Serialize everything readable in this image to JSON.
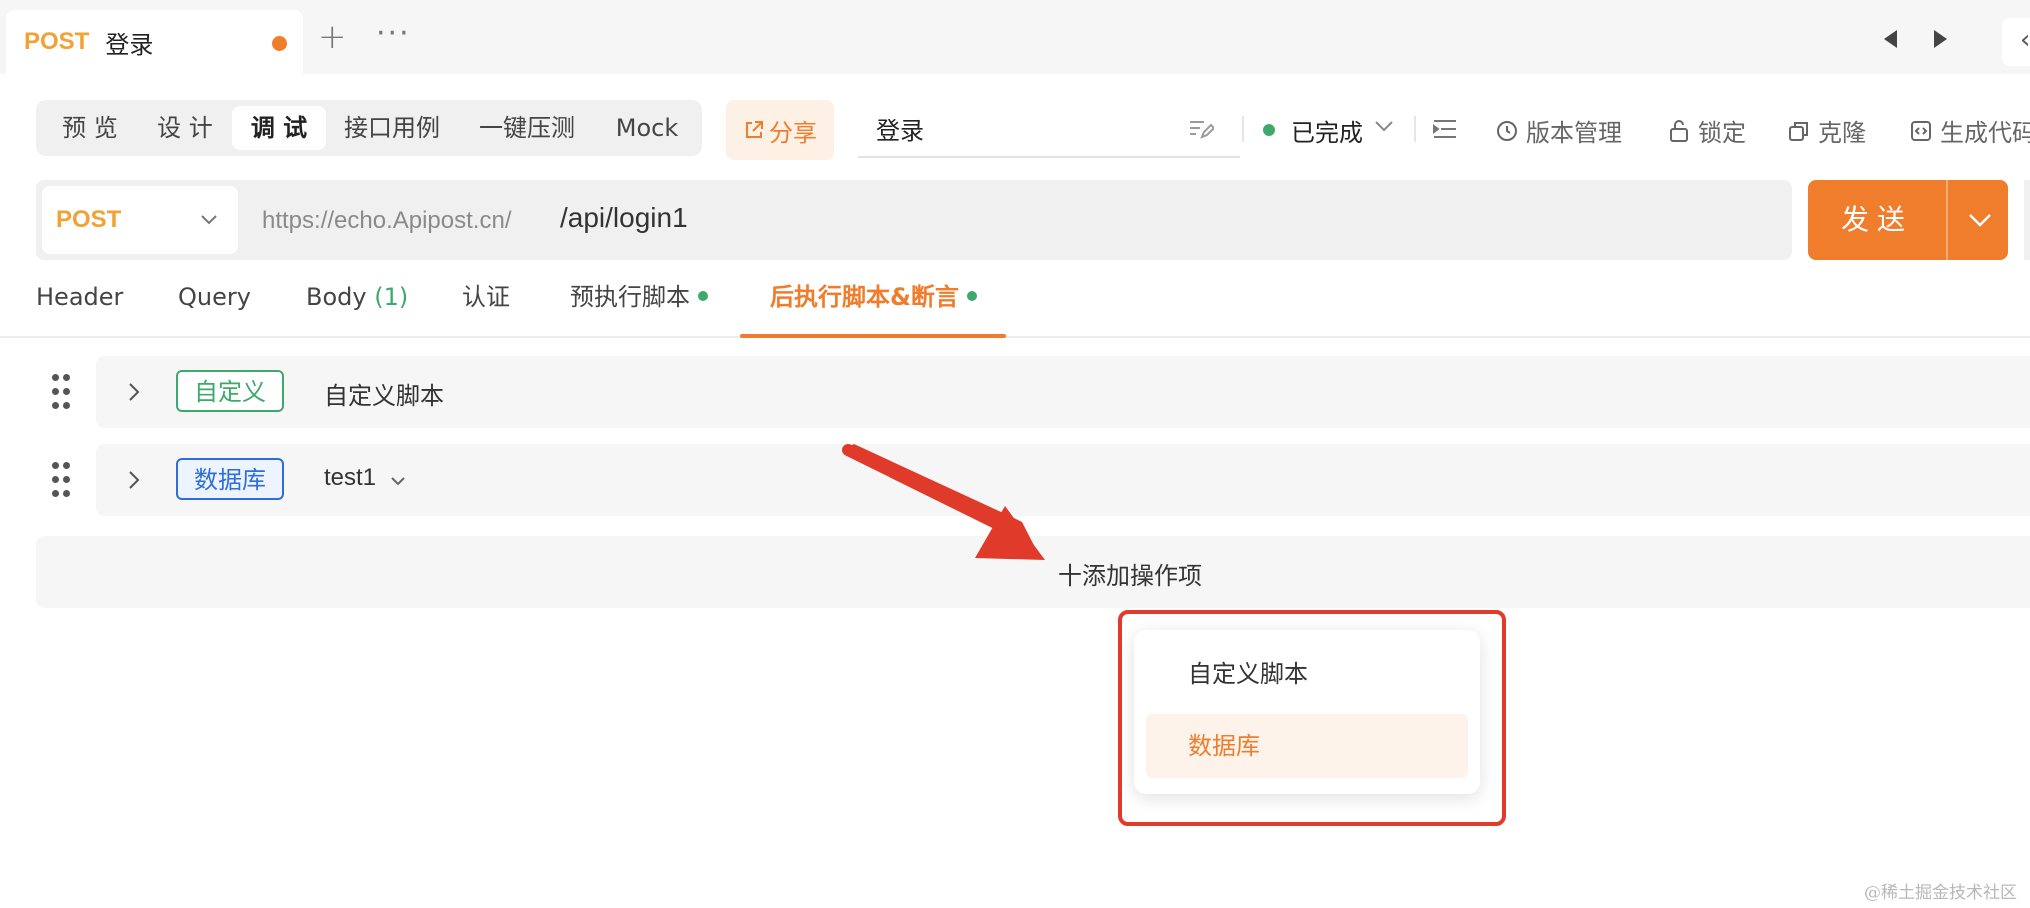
{
  "tab": {
    "method": "POST",
    "title": "登录",
    "add_glyph": "+",
    "more_glyph": "···",
    "edge_glyph": "‹"
  },
  "toolbar": {
    "view_modes": [
      "预 览",
      "设 计",
      "调 试",
      "接口用例",
      "一键压测",
      "Mock"
    ],
    "active_view": "调 试",
    "share_label": "分享",
    "name_value": "登录",
    "status_label": "已完成",
    "status_color": "#3daa6b",
    "version_label": "版本管理",
    "lock_label": "锁定",
    "clone_label": "克隆",
    "codegen_label": "生成代码"
  },
  "request": {
    "method": "POST",
    "base_url": "https://echo.Apipost.cn/",
    "path": "/api/login1",
    "send_label": "发送"
  },
  "tabs": {
    "header": "Header",
    "query": "Query",
    "body": "Body",
    "body_count": "(1)",
    "auth": "认证",
    "pre_script": "预执行脚本",
    "post_script": "后执行脚本&断言"
  },
  "script_rows": [
    {
      "tag": "自定义",
      "label": "自定义脚本"
    },
    {
      "tag": "数据库",
      "label": "test1"
    }
  ],
  "add_action": "十添加操作项",
  "dropdown": {
    "items": [
      "自定义脚本",
      "数据库"
    ],
    "hovered": "数据库"
  },
  "watermark": "@稀土掘金技术社区",
  "colors": {
    "accent": "#ef7d2c",
    "method": "#f0a235",
    "green": "#3daa6b",
    "blue": "#2f6ed8",
    "annotation_red": "#e03a2a"
  }
}
